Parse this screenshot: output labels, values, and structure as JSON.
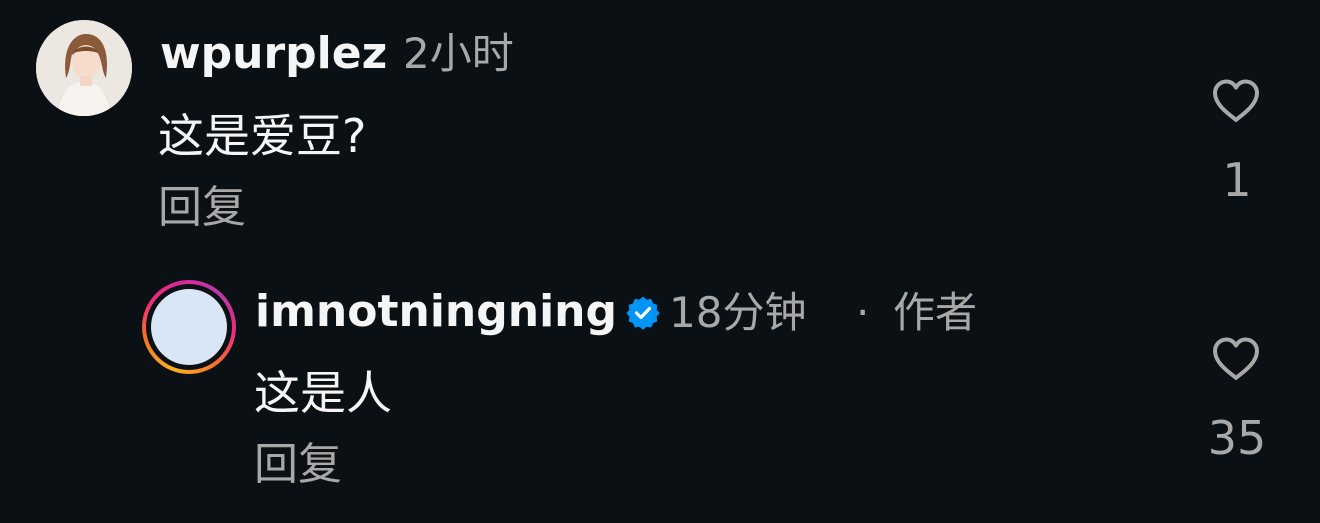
{
  "comments": [
    {
      "username": "wpurplez",
      "time": "2小时",
      "text": "这是爱豆?",
      "reply_label": "回复",
      "like_count": "1",
      "avatar_icon": "user-avatar-illustration"
    },
    {
      "username": "imnotningning",
      "verified": true,
      "time": "18分钟",
      "separator": "·",
      "author_tag": "作者",
      "text": "这是人",
      "reply_label": "回复",
      "like_count": "35",
      "avatar_icon": "user-avatar-story-ring"
    }
  ],
  "colors": {
    "background": "#0b1014",
    "primary_text": "#f5f5f5",
    "secondary_text": "#a8a8a8",
    "verified_badge": "#0095f6"
  }
}
